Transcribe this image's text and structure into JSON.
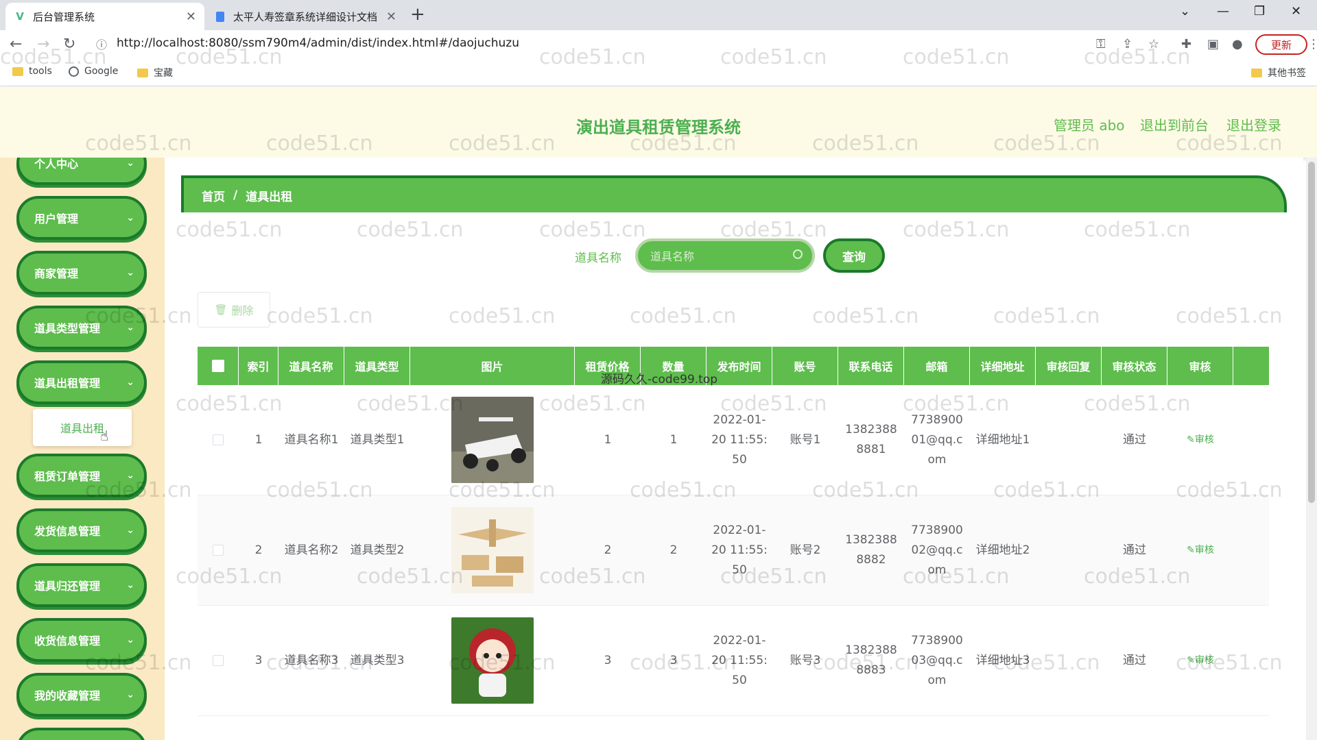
{
  "browser": {
    "tabs": [
      {
        "title": "后台管理系统",
        "icon": "vue-icon"
      },
      {
        "title": "太平人寿签章系统详细设计文档",
        "icon": "doc-icon"
      }
    ],
    "url": "http://localhost:8080/ssm790m4/admin/dist/index.html#/daojuchuzu",
    "update_label": "更新",
    "bookmarks": [
      "tools",
      "Google",
      "宝藏"
    ],
    "other_bookmarks": "其他书签"
  },
  "header": {
    "title": "演出道具租赁管理系统",
    "admin": "管理员 abo",
    "to_front": "退出到前台",
    "logout": "退出登录"
  },
  "sidebar": {
    "items": [
      "个人中心",
      "用户管理",
      "商家管理",
      "道具类型管理",
      "道具出租管理",
      "租赁订单管理",
      "发货信息管理",
      "道具归还管理",
      "收货信息管理",
      "我的收藏管理"
    ],
    "submenu": "道具出租"
  },
  "breadcrumb": {
    "home": "首页",
    "sep": "/",
    "current": "道具出租"
  },
  "search": {
    "label": "道具名称",
    "placeholder": "道具名称",
    "button": "查询"
  },
  "actions": {
    "delete": "删除"
  },
  "table": {
    "headers": [
      "索引",
      "道具名称",
      "道具类型",
      "图片",
      "租赁价格",
      "数量",
      "发布时间",
      "账号",
      "联系电话",
      "邮箱",
      "详细地址",
      "审核回复",
      "审核状态",
      "审核"
    ],
    "rows": [
      {
        "index": "1",
        "name": "道具名称1",
        "type": "道具类型1",
        "price": "1",
        "qty": "1",
        "time": "2022-01-20 11:55:50",
        "account": "账号1",
        "phone": "13823888881",
        "email": "773890001@qq.com",
        "address": "详细地址1",
        "reply": "",
        "status": "通过",
        "audit": "审核"
      },
      {
        "index": "2",
        "name": "道具名称2",
        "type": "道具类型2",
        "price": "2",
        "qty": "2",
        "time": "2022-01-20 11:55:50",
        "account": "账号2",
        "phone": "13823888882",
        "email": "773890002@qq.com",
        "address": "详细地址2",
        "reply": "",
        "status": "通过",
        "audit": "审核"
      },
      {
        "index": "3",
        "name": "道具名称3",
        "type": "道具类型3",
        "price": "3",
        "qty": "3",
        "time": "2022-01-20 11:55:50",
        "account": "账号3",
        "phone": "13823888883",
        "email": "773890003@qq.com",
        "address": "详细地址3",
        "reply": "",
        "status": "通过",
        "audit": "审核"
      }
    ]
  },
  "overlay": "源码久久-code99.top",
  "watermark": "code51.cn",
  "colors": {
    "primary": "#5ebd4d",
    "dark": "#1a7a2a",
    "sidebar_bg": "#fbe9c3",
    "header_bg": "#fdfbe6"
  }
}
